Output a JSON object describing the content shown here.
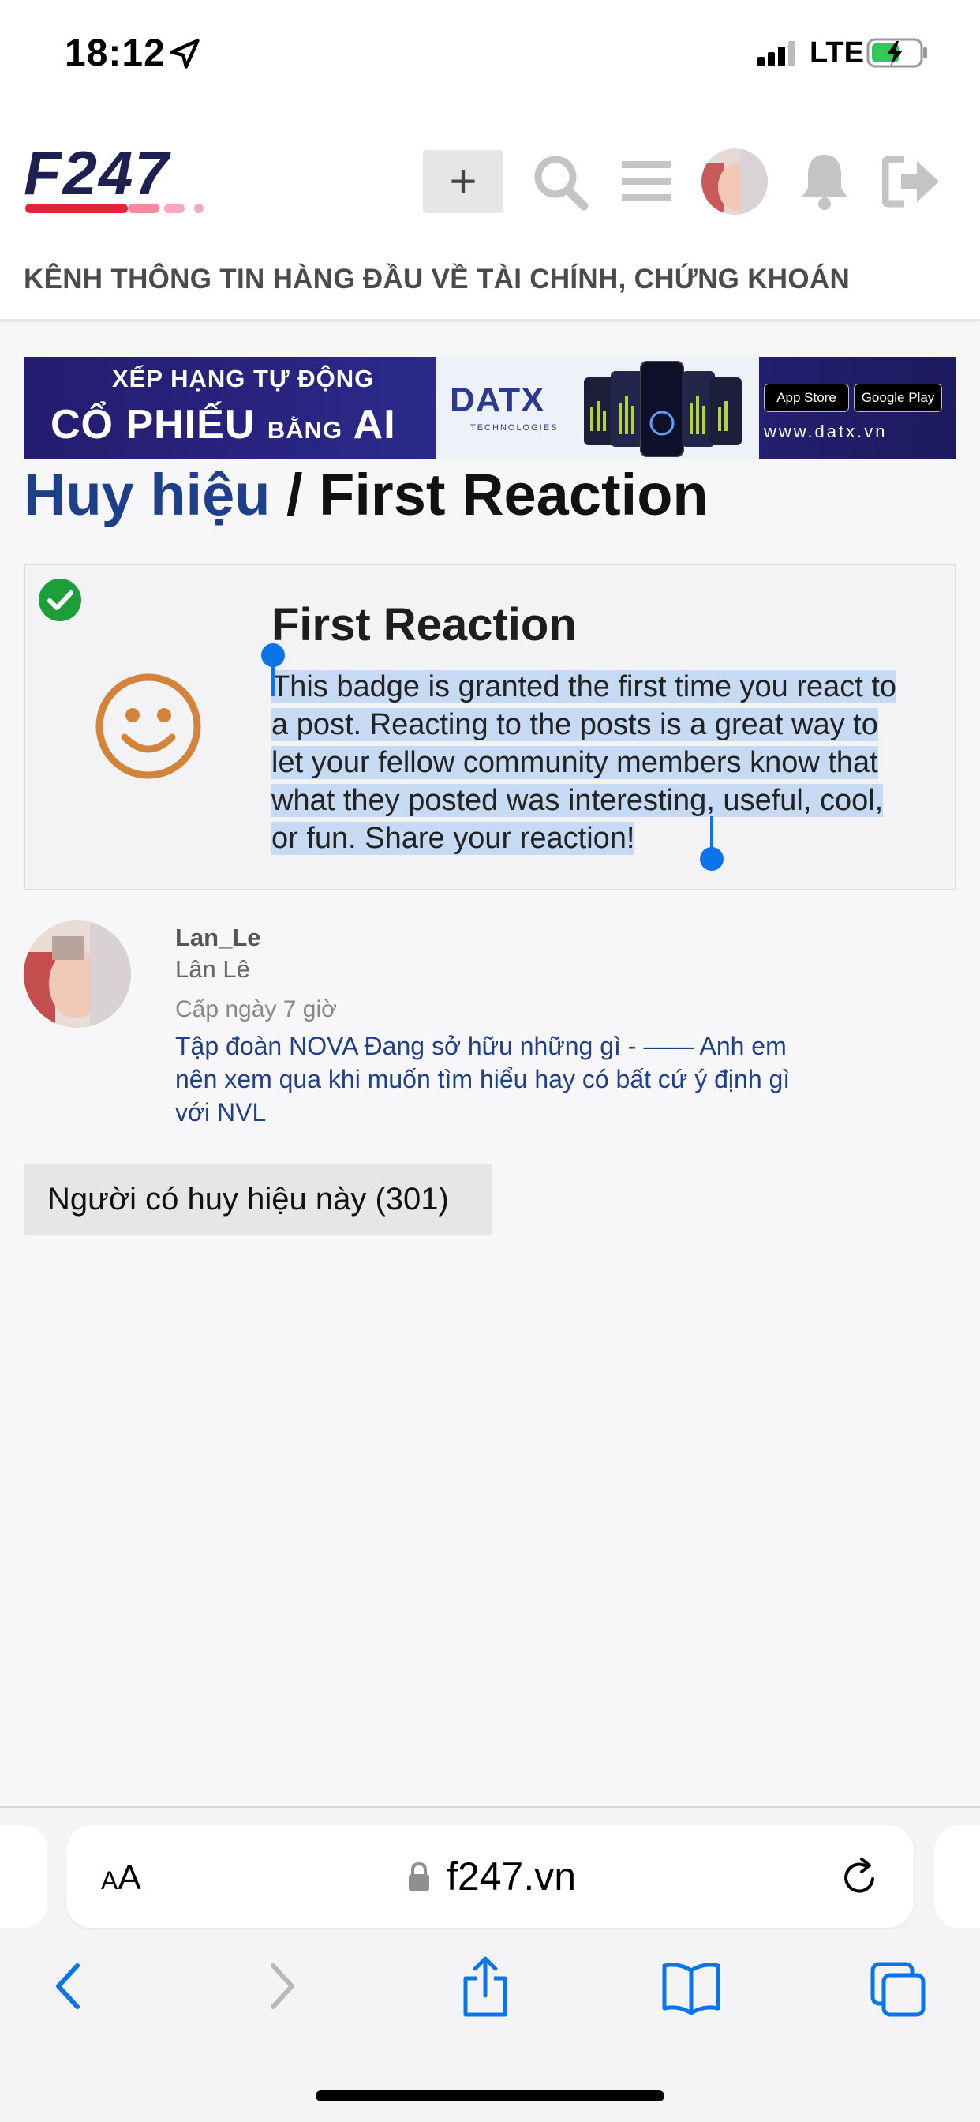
{
  "status": {
    "time": "18:12",
    "network": "LTE"
  },
  "header": {
    "logo_text": "F247",
    "tagline": "KÊNH THÔNG TIN HÀNG ĐẦU VỀ TÀI CHÍNH, CHỨNG KHOÁN",
    "plus_label": "+",
    "accent_color": "#e3243b",
    "brand_color": "#1f2052"
  },
  "banner": {
    "line1": "XẾP HẠNG TỰ ĐỘNG",
    "line2_main": "CỔ PHIẾU",
    "line2_small": "BẰNG",
    "line2_ai": "AI",
    "brand": "DATX",
    "brand_sub": "TECHNOLOGIES",
    "app_store": "App Store",
    "google_play": "Google Play",
    "url": "www.datx.vn"
  },
  "page": {
    "breadcrumb": "Huy hiệu",
    "separator": " / ",
    "title": "First Reaction"
  },
  "badge": {
    "title": "First Reaction",
    "description": "This badge is granted the first time you react to a post. Reacting to the posts is a great way to let your fellow community members know that what they posted was interesting, useful, cool, or fun. Share your reaction!"
  },
  "grant": {
    "username": "Lan_Le",
    "real_name": "Lân Lê",
    "granted": "Cấp ngày 7 giờ",
    "post_link": "Tập đoàn NOVA Đang sở hữu những gì - —— Anh em nên xem qua khi muốn tìm hiểu hay có bất cứ ý định gì với NVL"
  },
  "holders_button": "Người có huy hiệu này (301)",
  "browser": {
    "aa_label": "AA",
    "domain": "f247.vn"
  }
}
